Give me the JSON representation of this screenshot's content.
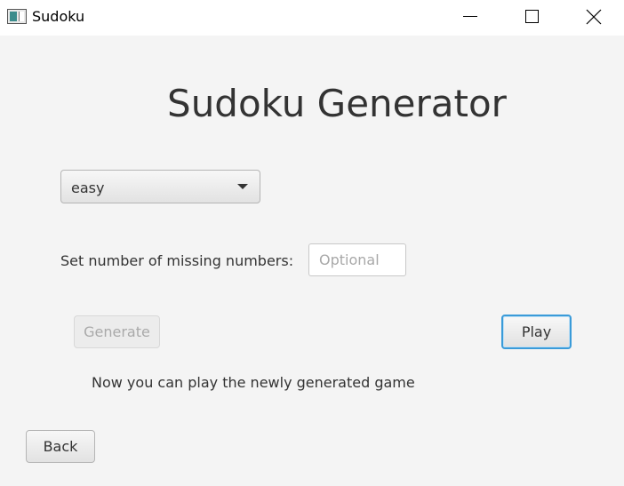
{
  "window": {
    "title": "Sudoku",
    "icon": "app-window-icon",
    "controls": [
      "minimize-icon",
      "maximize-icon",
      "close-icon"
    ]
  },
  "main": {
    "heading": "Sudoku Generator",
    "difficulty": {
      "selected": "easy",
      "icon": "chevron-down-icon"
    },
    "missing_numbers": {
      "label": "Set number of missing numbers:",
      "value": "",
      "placeholder": "Optional"
    },
    "generate_label": "Generate",
    "play_label": "Play",
    "status_message": "Now you can play the newly generated game",
    "back_label": "Back"
  },
  "colors": {
    "background": "#f4f4f4",
    "focus_accent": "#3a9bd9",
    "disabled_text": "#a9a9a9"
  }
}
